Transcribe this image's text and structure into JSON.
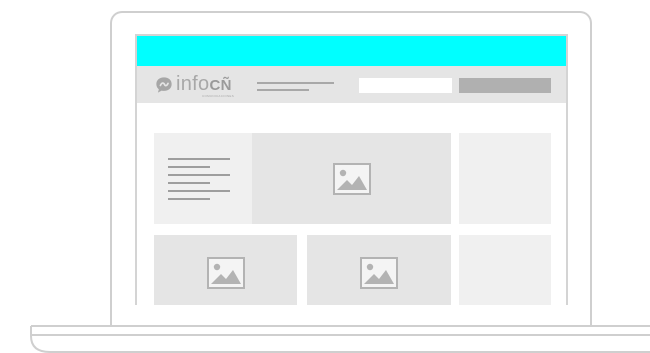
{
  "brand": {
    "name_light": "info",
    "name_bold": "CÑ",
    "tagline": "COMUNICACIONES"
  },
  "colors": {
    "accent_bar": "#00ffff",
    "nav_background": "#e5e5e5",
    "placeholder": "#e5e5e5",
    "card": "#f0f0f0"
  },
  "icons": {
    "logo": "chat-bubble-icon",
    "placeholder": "image-placeholder-icon"
  }
}
